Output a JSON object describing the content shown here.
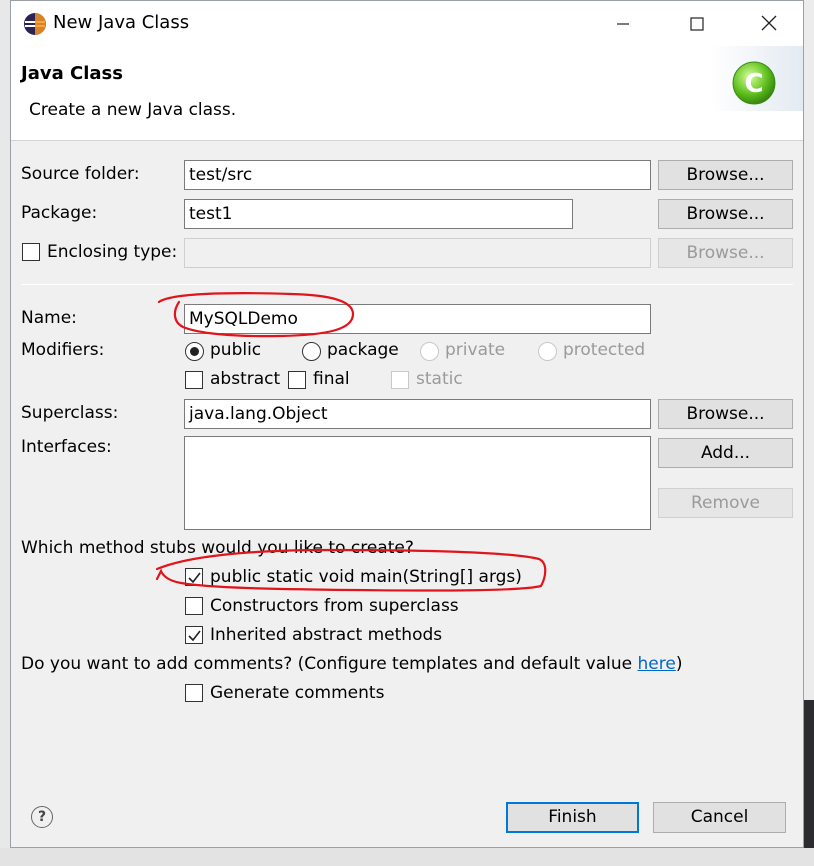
{
  "window": {
    "title": "New Java Class",
    "minimize_icon": "minimize-icon",
    "maximize_icon": "maximize-icon",
    "close_icon": "close-icon"
  },
  "banner": {
    "title": "Java Class",
    "description": "Create a new Java class.",
    "art_icon": "java-class-wizard-icon",
    "art_letter": "C"
  },
  "form": {
    "source_folder": {
      "label": "Source folder:",
      "value": "test/src",
      "button": "Browse..."
    },
    "package": {
      "label": "Package:",
      "value": "test1",
      "button": "Browse..."
    },
    "enclosing_type": {
      "label": "Enclosing type:",
      "checked": false,
      "value": "",
      "button": "Browse..."
    },
    "name": {
      "label": "Name:",
      "value": "MySQLDemo"
    },
    "modifiers": {
      "label": "Modifiers:",
      "options": [
        "public",
        "package",
        "private",
        "protected"
      ],
      "selected": "public",
      "abstract": "abstract",
      "final": "final",
      "static": "static"
    },
    "superclass": {
      "label": "Superclass:",
      "value": "java.lang.Object",
      "button": "Browse..."
    },
    "interfaces": {
      "label": "Interfaces:",
      "add_button": "Add...",
      "remove_button": "Remove"
    },
    "stubs": {
      "question": "Which method stubs would you like to create?",
      "main": {
        "label": "public static void main(String[] args)",
        "checked": true
      },
      "constructors": {
        "label": "Constructors from superclass",
        "checked": false
      },
      "inherited": {
        "label": "Inherited abstract methods",
        "checked": true
      }
    },
    "comments": {
      "question": "Do you want to add comments? (Configure templates and default value ",
      "link": "here",
      "close_paren": ")",
      "generate": {
        "label": "Generate comments",
        "checked": false
      }
    }
  },
  "footer": {
    "help_icon": "help-icon",
    "help_glyph": "?",
    "finish": "Finish",
    "cancel": "Cancel"
  },
  "annotation_color": "#e0141b"
}
